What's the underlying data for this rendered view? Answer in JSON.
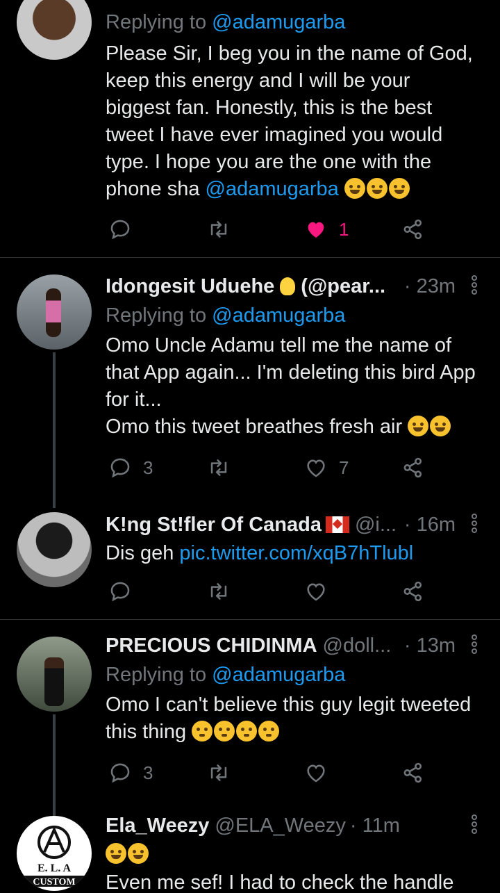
{
  "tweets": [
    {
      "name": "",
      "handle": "",
      "time": "",
      "reply_prefix": "Replying to",
      "reply_handle": "@adamugarba",
      "text": "Please Sir, I beg you in the name of God, keep this energy and I will be your biggest fan. Honestly, this is the best tweet I have ever imagined you would type. I hope you are the one with the phone sha ",
      "text_link": "@adamugarba",
      "emojis": [
        "rolling-laughing-emoji",
        "rolling-laughing-emoji",
        "rolling-laughing-emoji"
      ],
      "reply_count": "",
      "like_count": "1",
      "liked": true
    },
    {
      "name": "Idongesit Uduehe",
      "name_icon": "light-bulb-emoji",
      "handle": "(@pear...",
      "time": "· 23m",
      "reply_prefix": "Replying to",
      "reply_handle": "@adamugarba",
      "text": "Omo Uncle Adamu tell me the name of that App again... I'm deleting this bird App for it...\nOmo this tweet breathes fresh air ",
      "emojis": [
        "weary-face-emoji",
        "tears-of-joy-emoji"
      ],
      "reply_count": "3",
      "like_count": "7",
      "liked": false
    },
    {
      "name": "K!ng St!fler Of Canada",
      "name_icon": "canada-flag-emoji",
      "handle": "@i...",
      "time": "· 16m",
      "text": "Dis geh ",
      "text_link": "pic.twitter.com/xqB7hTlubl",
      "reply_count": "",
      "like_count": "",
      "liked": false
    },
    {
      "name": "PRECIOUS CHIDINMA",
      "handle": "@doll...",
      "time": "· 13m",
      "reply_prefix": "Replying to",
      "reply_handle": "@adamugarba",
      "text": "Omo I can't believe this guy legit tweeted this thing ",
      "emojis": [
        "flushed-face-emoji",
        "flushed-face-emoji",
        "flushed-face-emoji",
        "flushed-face-emoji"
      ],
      "reply_count": "3",
      "like_count": "",
      "liked": false
    },
    {
      "name": "Ela_Weezy",
      "handle": "@ELA_Weezy",
      "time": "· 11m",
      "emojis": [
        "tears-of-joy-emoji",
        "tears-of-joy-emoji"
      ],
      "text": "Even me sef! I had to check the handle",
      "avatar_logo_text": "E. L. A CUSTOM"
    }
  ]
}
